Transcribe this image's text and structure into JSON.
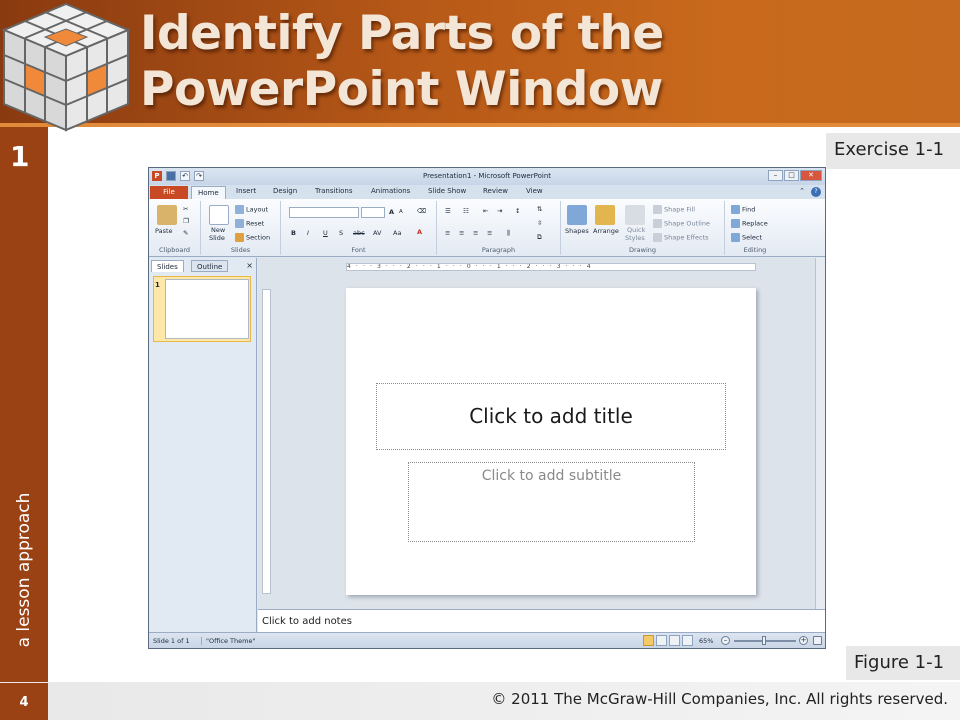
{
  "slide": {
    "title_line1": "Identify Parts of the",
    "title_line2": "PowerPoint Window",
    "lesson_number": "1",
    "side_text": "a lesson approach",
    "exercise_label": "Exercise 1-1",
    "figure_label": "Figure 1-1",
    "page_number": "4",
    "copyright": "© 2011 The McGraw-Hill Companies, Inc. All rights reserved.",
    "colors": {
      "brand_orange": "#c8691c",
      "sidebar_brown": "#9b4214",
      "title_text": "#f4e6d6"
    }
  },
  "ppt": {
    "window_title": "Presentation1 - Microsoft PowerPoint",
    "qat_undo": "↶",
    "qat_redo": "↷",
    "ctrl_min": "–",
    "ctrl_max": "□",
    "ctrl_close": "✕",
    "tabs": [
      "File",
      "Home",
      "Insert",
      "Design",
      "Transitions",
      "Animations",
      "Slide Show",
      "Review",
      "View"
    ],
    "ribbon": {
      "clipboard": {
        "label": "Clipboard",
        "paste": "Paste"
      },
      "slides": {
        "label": "Slides",
        "new_slide_1": "New",
        "new_slide_2": "Slide",
        "layout": "Layout",
        "reset": "Reset",
        "section": "Section"
      },
      "font": {
        "label": "Font",
        "bold": "B",
        "italic": "I",
        "underline": "U",
        "shadow": "S",
        "strike": "abc",
        "spacing": "AV",
        "case": "Aa",
        "color": "A",
        "grow": "A",
        "shrink": "A"
      },
      "paragraph": {
        "label": "Paragraph"
      },
      "drawing": {
        "label": "Drawing",
        "shapes": "Shapes",
        "arrange": "Arrange",
        "quick_1": "Quick",
        "quick_2": "Styles",
        "shape_fill": "Shape Fill",
        "shape_outline": "Shape Outline",
        "shape_effects": "Shape Effects"
      },
      "editing": {
        "label": "Editing",
        "find": "Find",
        "replace": "Replace",
        "select": "Select"
      }
    },
    "left_pane": {
      "tab_slides": "Slides",
      "tab_outline": "Outline",
      "close": "×",
      "thumb_number": "1"
    },
    "ruler_text": "4 · · · 3 · · · 2 · · · 1 · · · 0 · · · 1 · · · 2 · · · 3 · · · 4",
    "placeholder_title": "Click to add title",
    "placeholder_subtitle": "Click to add subtitle",
    "notes_placeholder": "Click to add notes",
    "status": {
      "slide_of": "Slide 1 of 1",
      "theme": "\"Office Theme\"",
      "zoom": "65%",
      "zoom_minus": "–",
      "zoom_plus": "+"
    }
  }
}
